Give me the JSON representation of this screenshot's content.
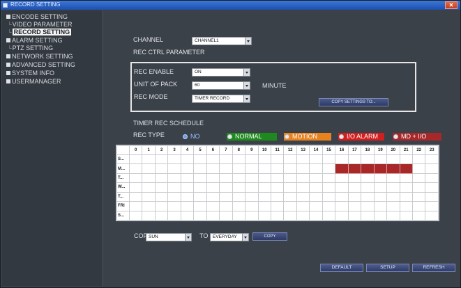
{
  "window": {
    "title": "RECORD SETTING"
  },
  "sidebar": {
    "items": [
      {
        "label": "ENCODE SETTING",
        "type": "parent"
      },
      {
        "label": "VIDEO PARAMETER",
        "type": "child"
      },
      {
        "label": "RECORD SETTING",
        "type": "child",
        "selected": true
      },
      {
        "label": "ALARM SETTING",
        "type": "parent"
      },
      {
        "label": "PTZ SETTING",
        "type": "child"
      },
      {
        "label": "NETWORK SETTING",
        "type": "parent"
      },
      {
        "label": "ADVANCED SETTING",
        "type": "parent"
      },
      {
        "label": "SYSTEM INFO",
        "type": "parent"
      },
      {
        "label": "USERMANAGER",
        "type": "parent"
      }
    ]
  },
  "channel": {
    "label": "CHANNEL",
    "value": "CHANNEL1"
  },
  "rec_ctrl": {
    "title": "REC CTRL PARAMETER",
    "enable_label": "REC ENABLE",
    "enable_value": "ON",
    "pack_label": "UNIT OF PACK",
    "pack_value": "60",
    "pack_unit": "MINUTE",
    "mode_label": "REC MODE",
    "mode_value": "TIMER RECORD",
    "copy_settings_button": "COPY SETTINGS TO..."
  },
  "schedule": {
    "title": "TIMER REC SCHEDULE",
    "rec_type_label": "REC TYPE",
    "types": [
      {
        "label": "NO",
        "color": "#6f9de0",
        "checked": true
      },
      {
        "label": "NORMAL",
        "color": "#1e8a1e"
      },
      {
        "label": "MOTION",
        "color": "#e8821e"
      },
      {
        "label": "I/O ALARM",
        "color": "#d21e1e"
      },
      {
        "label": "MD + I/O",
        "color": "#a8282a"
      }
    ],
    "hours": [
      "0",
      "1",
      "2",
      "3",
      "4",
      "5",
      "6",
      "7",
      "8",
      "9",
      "10",
      "11",
      "12",
      "13",
      "14",
      "15",
      "16",
      "17",
      "18",
      "19",
      "20",
      "21",
      "22",
      "23"
    ],
    "days": [
      "S...",
      "M...",
      "T...",
      "W...",
      "T...",
      "FRI",
      "S..."
    ],
    "active": [
      [],
      [
        16,
        17,
        18,
        19,
        20,
        21
      ],
      [],
      [],
      [],
      [],
      []
    ],
    "active_color": "#a8282a"
  },
  "copy": {
    "label": "COPY",
    "from_value": "SUN",
    "to_label": "TO",
    "to_value": "EVERYDAY",
    "button": "COPY"
  },
  "footer": {
    "default_button": "DEFAULT",
    "setup_button": "SETUP",
    "refresh_button": "REFRESH"
  }
}
